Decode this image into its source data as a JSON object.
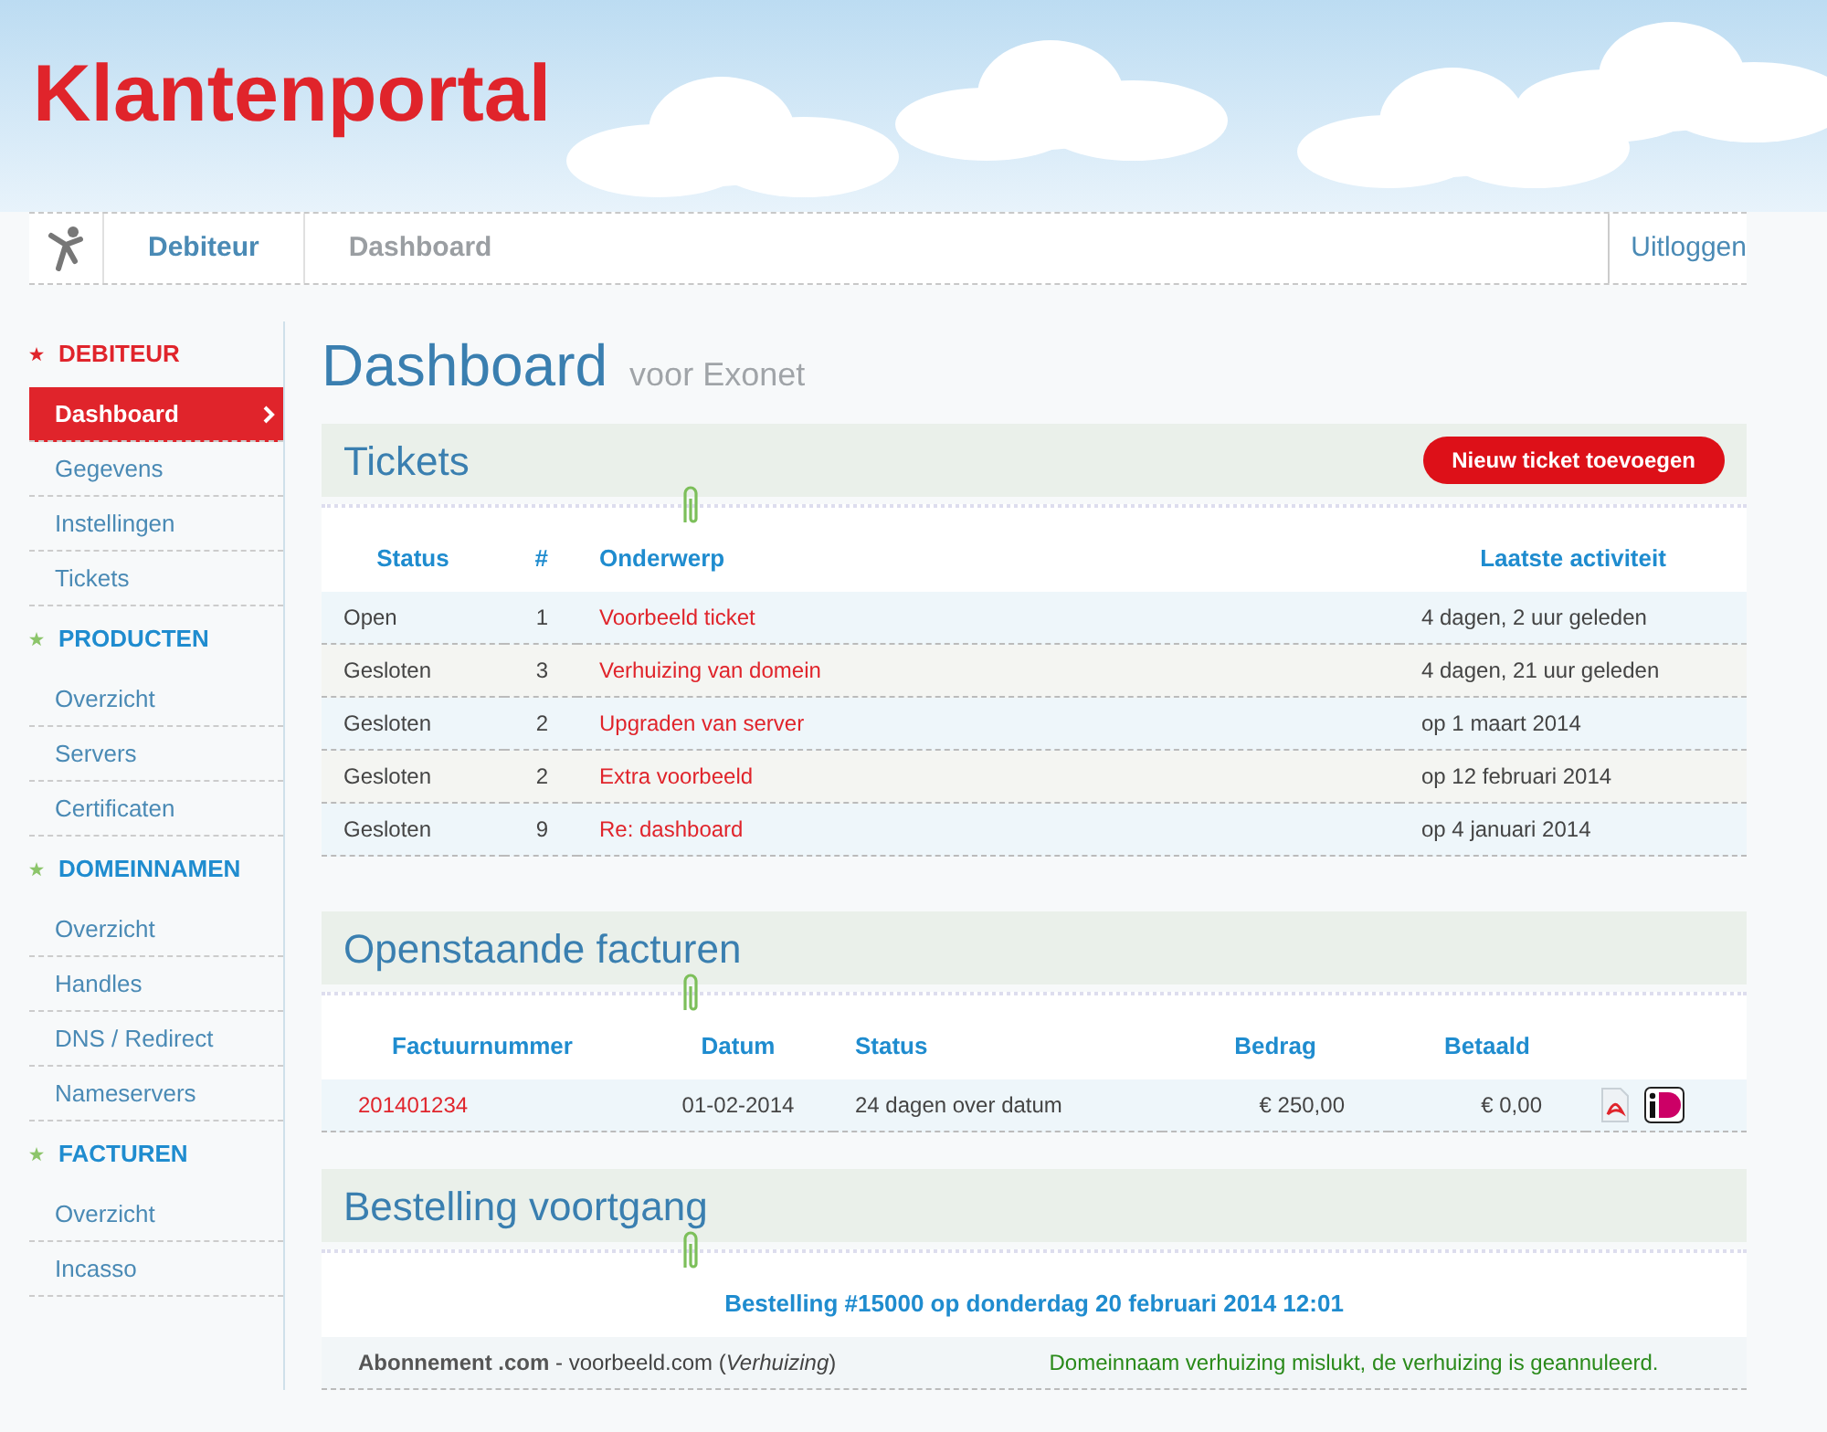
{
  "header": {
    "title": "Klantenportal"
  },
  "breadcrumb": {
    "items": [
      {
        "label": "Debiteur",
        "selected": false
      },
      {
        "label": "Dashboard",
        "selected": true
      }
    ],
    "logout": "Uitloggen"
  },
  "sidebar": {
    "sections": [
      {
        "label": "DEBITEUR",
        "selected": true,
        "items": [
          {
            "label": "Dashboard",
            "selected": true
          },
          {
            "label": "Gegevens",
            "selected": false
          },
          {
            "label": "Instellingen",
            "selected": false
          },
          {
            "label": "Tickets",
            "selected": false
          }
        ]
      },
      {
        "label": "PRODUCTEN",
        "selected": false,
        "items": [
          {
            "label": "Overzicht",
            "selected": false
          },
          {
            "label": "Servers",
            "selected": false
          },
          {
            "label": "Certificaten",
            "selected": false
          }
        ]
      },
      {
        "label": "DOMEINNAMEN",
        "selected": false,
        "items": [
          {
            "label": "Overzicht",
            "selected": false
          },
          {
            "label": "Handles",
            "selected": false
          },
          {
            "label": "DNS / Redirect",
            "selected": false
          },
          {
            "label": "Nameservers",
            "selected": false
          }
        ]
      },
      {
        "label": "FACTUREN",
        "selected": false,
        "items": [
          {
            "label": "Overzicht",
            "selected": false
          },
          {
            "label": "Incasso",
            "selected": false
          }
        ]
      }
    ]
  },
  "page": {
    "title": "Dashboard",
    "subtitle": "voor Exonet"
  },
  "tickets": {
    "title": "Tickets",
    "button": "Nieuw ticket toevoegen",
    "columns": [
      "Status",
      "#",
      "Onderwerp",
      "Laatste activiteit"
    ],
    "rows": [
      {
        "status": "Open",
        "number": "1",
        "subject": "Voorbeeld ticket",
        "activity": "4 dagen, 2 uur geleden"
      },
      {
        "status": "Gesloten",
        "number": "3",
        "subject": "Verhuizing van domein",
        "activity": "4 dagen, 21 uur geleden"
      },
      {
        "status": "Gesloten",
        "number": "2",
        "subject": "Upgraden van server",
        "activity": "op 1 maart 2014"
      },
      {
        "status": "Gesloten",
        "number": "2",
        "subject": "Extra voorbeeld",
        "activity": "op 12 februari 2014"
      },
      {
        "status": "Gesloten",
        "number": "9",
        "subject": "Re: dashboard",
        "activity": "op 4 januari 2014"
      }
    ]
  },
  "invoices": {
    "title": "Openstaande facturen",
    "columns": [
      "Factuurnummer",
      "Datum",
      "Status",
      "Bedrag",
      "Betaald"
    ],
    "rows": [
      {
        "number": "201401234",
        "date": "01-02-2014",
        "status": "24 dagen over datum",
        "amount": "€ 250,00",
        "paid": "€ 0,00"
      }
    ]
  },
  "orders": {
    "title": "Bestelling voortgang",
    "heading": "Bestelling #15000 op donderdag 20 februari 2014 12:01",
    "rows": [
      {
        "product": "**Abonnement .com** - voorbeeld.com (*Verhuizing*)",
        "message": "Domeinnaam verhuizing mislukt, de verhuizing is geannuleerd."
      }
    ]
  }
}
